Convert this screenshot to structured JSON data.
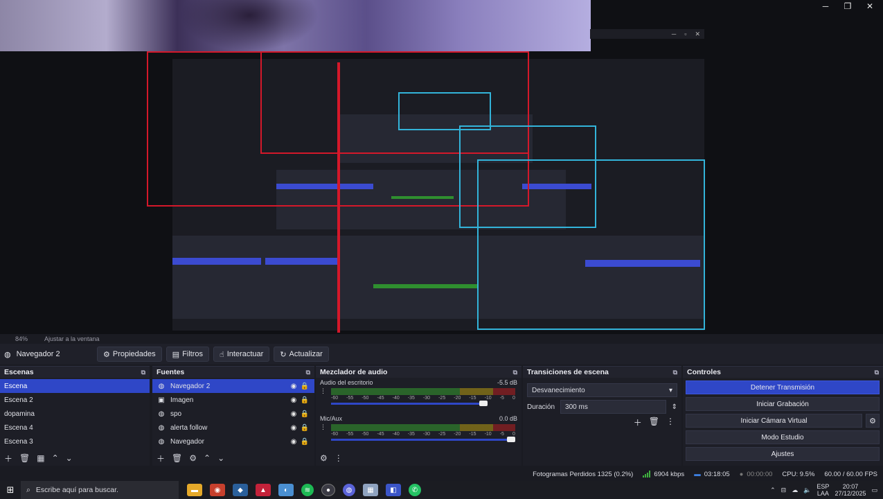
{
  "preview": {
    "zoom_label": "84%",
    "fit_label": "Ajustar a la ventana"
  },
  "toolbar": {
    "source_name": "Navegador 2",
    "properties_label": "Propiedades",
    "filters_label": "Filtros",
    "interact_label": "Interactuar",
    "refresh_label": "Actualizar"
  },
  "scenes": {
    "title": "Escenas",
    "items": [
      "Escena",
      "Escena 2",
      "dopamina",
      "Escena 4",
      "Escena 3"
    ],
    "selected": "Escena"
  },
  "sources": {
    "title": "Fuentes",
    "items": [
      {
        "name": "Navegador 2",
        "icon": "globe-icon",
        "selected": true
      },
      {
        "name": "Imagen",
        "icon": "image-icon",
        "selected": false
      },
      {
        "name": "spo",
        "icon": "globe-icon",
        "selected": false
      },
      {
        "name": "alerta follow",
        "icon": "globe-icon",
        "selected": false
      },
      {
        "name": "Navegador",
        "icon": "globe-icon",
        "selected": false
      }
    ]
  },
  "mixer": {
    "title": "Mezclador de audio",
    "channels": [
      {
        "name": "Audio del escritorio",
        "level": "-5.5 dB",
        "fader": 0.85
      },
      {
        "name": "Mic/Aux",
        "level": "0.0 dB",
        "fader": 1.0
      }
    ],
    "ticks": [
      "-60",
      "-55",
      "-50",
      "-45",
      "-40",
      "-35",
      "-30",
      "-25",
      "-20",
      "-15",
      "-10",
      "-5",
      "0"
    ]
  },
  "transitions": {
    "title": "Transiciones de escena",
    "selected": "Desvanecimiento",
    "duration_label": "Duración",
    "duration_value": "300 ms"
  },
  "controls": {
    "title": "Controles",
    "stop_stream": "Detener Transmisión",
    "start_recording": "Iniciar Grabación",
    "start_virtual_cam": "Iniciar Cámara Virtual",
    "studio_mode": "Modo Estudio",
    "settings": "Ajustes"
  },
  "status": {
    "dropped_frames": "Fotogramas Perdidos 1325 (0.2%)",
    "bitrate": "6904 kbps",
    "stream_time": "03:18:05",
    "rec_time": "00:00:00",
    "cpu": "CPU: 9.5%",
    "fps": "60.00 / 60.00 FPS"
  },
  "taskbar": {
    "search_placeholder": "Escribe aquí para buscar.",
    "lang_top": "ESP",
    "lang_bottom": "LAA",
    "time": "20:07",
    "date": "27/12/2025"
  },
  "colors": {
    "accent": "#2f47c7",
    "selection_red": "#d5182a",
    "selection_cyan": "#33b4da"
  }
}
